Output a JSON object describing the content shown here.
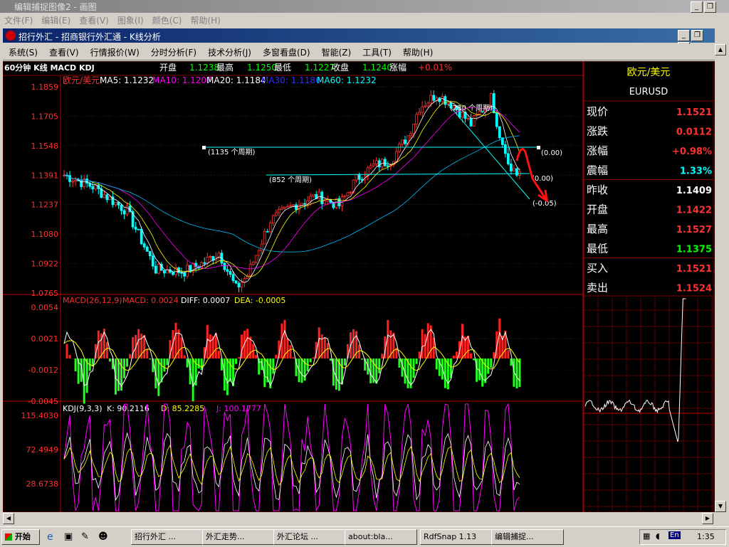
{
  "window": {
    "title": "编辑捕捉图像2 - 画图"
  },
  "main_menu": [
    "文件(F)",
    "编辑(E)",
    "查看(V)",
    "图象(I)",
    "颜色(C)",
    "帮助(H)"
  ],
  "inner_window": {
    "title": "招行外汇 - 招商银行外汇通 - K线分析"
  },
  "app_menu": [
    "系统(S)",
    "查看(V)",
    "行情报价(W)",
    "分时分析(F)",
    "技术分析(J)",
    "多窗看盘(D)",
    "智能(Z)",
    "工具(T)",
    "帮助(H)"
  ],
  "quote_bar": {
    "period": "60分钟 K线 MACD KDJ",
    "open_label": "开盘",
    "open": "1.1238",
    "high_label": "最高",
    "high": "1.1250",
    "low_label": "最低",
    "low": "1.1227",
    "close_label": "收盘",
    "close": "1.1240",
    "change_label": "涨幅",
    "change": "+0.01%"
  },
  "price_panel": {
    "symbol_name": "欧元/美元",
    "ma": [
      {
        "label": "MA5: 1.1232",
        "color": "#ffffff"
      },
      {
        "label": "MA10: 1.1207",
        "color": "#ff00ff"
      },
      {
        "label": "MA20: 1.1184",
        "color": "#ffffff"
      },
      {
        "label": "MA30: 1.1186",
        "color": "#3030ff"
      },
      {
        "label": "MA60: 1.1232",
        "color": "#00ffff"
      }
    ],
    "y_ticks": [
      "1.1859",
      "1.1705",
      "1.1548",
      "1.1391",
      "1.1237",
      "1.1080",
      "1.0922",
      "1.0765"
    ],
    "annotations": [
      "(1135 个周期)",
      "(852 个周期)",
      "(280 个周期)",
      "(0.00)",
      "(0.00)",
      "(-0.05)"
    ]
  },
  "macd_panel": {
    "header": "MACD(26,12,9)",
    "macd": "MACD: 0.0024",
    "diff": "DIFF: 0.0007",
    "dea": "DEA: -0.0005",
    "y_ticks": [
      "0.0054",
      "0.0021",
      "-0.0012",
      "-0.0045"
    ]
  },
  "kdj_panel": {
    "header": "KDJ(9,3,3)",
    "k": "K: 90.2116",
    "d": "D: 85.2285",
    "j": "J: 100.1777",
    "y_ticks": [
      "115.4030",
      "72.4949",
      "28.6738"
    ]
  },
  "side_panel": {
    "name": "欧元/美元",
    "code": "EURUSD",
    "rows": [
      {
        "label": "现价",
        "value": "1.1521",
        "color": "#ff3030"
      },
      {
        "label": "涨跌",
        "value": "0.0112",
        "color": "#ff3030"
      },
      {
        "label": "涨幅",
        "value": "+0.98%",
        "color": "#ff3030"
      },
      {
        "label": "震幅",
        "value": "1.33%",
        "color": "#00ffff"
      },
      {
        "label": "昨收",
        "value": "1.1409",
        "color": "#ffffff"
      },
      {
        "label": "开盘",
        "value": "1.1422",
        "color": "#ff3030"
      },
      {
        "label": "最高",
        "value": "1.1527",
        "color": "#ff3030"
      },
      {
        "label": "最低",
        "value": "1.1375",
        "color": "#00ff00"
      },
      {
        "label": "买入",
        "value": "1.1521",
        "color": "#ff3030"
      },
      {
        "label": "卖出",
        "value": "1.1524",
        "color": "#ff3030"
      }
    ]
  },
  "taskbar": {
    "start": "开始",
    "tasks": [
      "招行外汇 ...",
      "外汇走势...",
      "外汇论坛 ...",
      "about:bla...",
      "RdfSnap 1.13",
      "编辑捕捉..."
    ],
    "lang": "En",
    "clock": "1:35"
  },
  "colors": {
    "up": "#ff3030",
    "down": "#00ffff",
    "grid": "#800000",
    "bg": "#000000"
  }
}
